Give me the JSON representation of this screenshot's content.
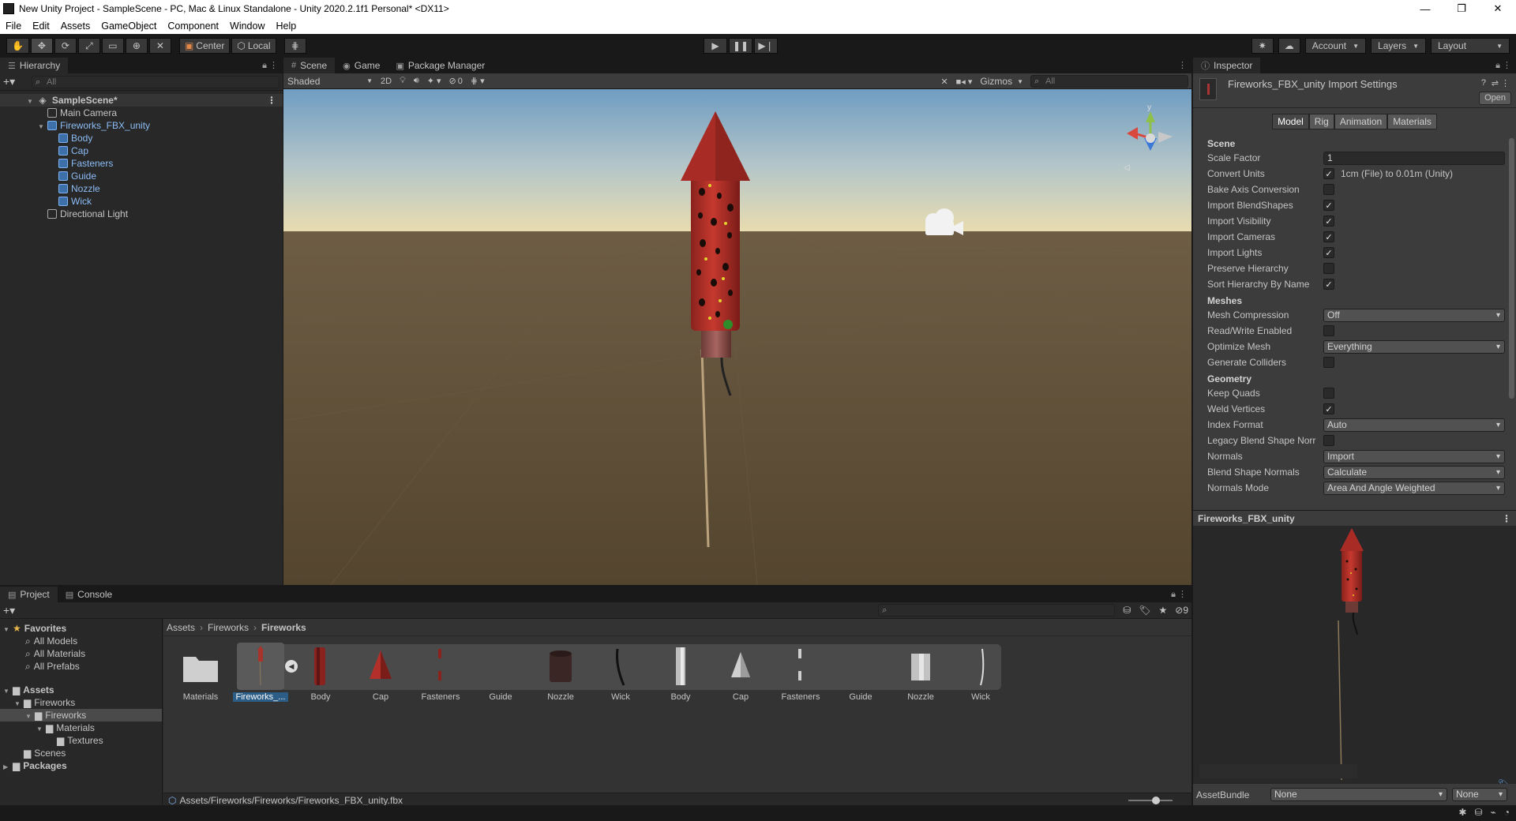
{
  "window": {
    "title": "New Unity Project - SampleScene - PC, Mac & Linux Standalone - Unity 2020.2.1f1 Personal* <DX11>",
    "controls": [
      "—",
      "❐",
      "✕"
    ]
  },
  "menu": [
    "File",
    "Edit",
    "Assets",
    "GameObject",
    "Component",
    "Window",
    "Help"
  ],
  "toolbar": {
    "pivot": "Center",
    "space": "Local",
    "account": "Account",
    "layers": "Layers",
    "layout": "Layout"
  },
  "hierarchy": {
    "tab": "Hierarchy",
    "search_placeholder": "All",
    "scene": "SampleScene*",
    "items": [
      {
        "label": "Main Camera",
        "depth": 1,
        "prefab": false,
        "expand": ""
      },
      {
        "label": "Fireworks_FBX_unity",
        "depth": 1,
        "prefab": true,
        "expand": "▼"
      },
      {
        "label": "Body",
        "depth": 2,
        "prefab": true,
        "expand": ""
      },
      {
        "label": "Cap",
        "depth": 2,
        "prefab": true,
        "expand": ""
      },
      {
        "label": "Fasteners",
        "depth": 2,
        "prefab": true,
        "expand": ""
      },
      {
        "label": "Guide",
        "depth": 2,
        "prefab": true,
        "expand": ""
      },
      {
        "label": "Nozzle",
        "depth": 2,
        "prefab": true,
        "expand": ""
      },
      {
        "label": "Wick",
        "depth": 2,
        "prefab": true,
        "expand": ""
      },
      {
        "label": "Directional Light",
        "depth": 1,
        "prefab": false,
        "expand": ""
      }
    ]
  },
  "scene_tabs": {
    "scene": "Scene",
    "game": "Game",
    "package_manager": "Package Manager"
  },
  "scene_toolbar": {
    "shading": "Shaded",
    "mode_2d": "2D",
    "hidden_count": "0",
    "gizmos": "Gizmos",
    "search_placeholder": "All"
  },
  "inspector": {
    "tab": "Inspector",
    "title": "Fireworks_FBX_unity Import Settings",
    "open_button": "Open",
    "tabs": [
      "Model",
      "Rig",
      "Animation",
      "Materials"
    ],
    "sections": [
      {
        "title": "Scene",
        "rows": [
          {
            "label": "Scale Factor",
            "type": "text",
            "value": "1"
          },
          {
            "label": "Convert Units",
            "type": "check",
            "checked": true,
            "note": "1cm (File) to 0.01m (Unity)"
          },
          {
            "label": "Bake Axis Conversion",
            "type": "check",
            "checked": false
          },
          {
            "label": "Import BlendShapes",
            "type": "check",
            "checked": true
          },
          {
            "label": "Import Visibility",
            "type": "check",
            "checked": true
          },
          {
            "label": "Import Cameras",
            "type": "check",
            "checked": true
          },
          {
            "label": "Import Lights",
            "type": "check",
            "checked": true
          },
          {
            "label": "Preserve Hierarchy",
            "type": "check",
            "checked": false
          },
          {
            "label": "Sort Hierarchy By Name",
            "type": "check",
            "checked": true
          }
        ]
      },
      {
        "title": "Meshes",
        "rows": [
          {
            "label": "Mesh Compression",
            "type": "dropdown",
            "value": "Off"
          },
          {
            "label": "Read/Write Enabled",
            "type": "check",
            "checked": false
          },
          {
            "label": "Optimize Mesh",
            "type": "dropdown",
            "value": "Everything"
          },
          {
            "label": "Generate Colliders",
            "type": "check",
            "checked": false
          }
        ]
      },
      {
        "title": "Geometry",
        "rows": [
          {
            "label": "Keep Quads",
            "type": "check",
            "checked": false
          },
          {
            "label": "Weld Vertices",
            "type": "check",
            "checked": true
          },
          {
            "label": "Index Format",
            "type": "dropdown",
            "value": "Auto"
          },
          {
            "label": "Legacy Blend Shape Norr",
            "type": "check",
            "checked": false
          },
          {
            "label": "Normals",
            "type": "dropdown",
            "value": "Import"
          },
          {
            "label": "Blend Shape Normals",
            "type": "dropdown",
            "value": "Calculate"
          },
          {
            "label": "Normals Mode",
            "type": "dropdown",
            "value": "Area And Angle Weighted"
          }
        ]
      }
    ],
    "preview_title": "Fireworks_FBX_unity",
    "assetbundle_label": "AssetBundle",
    "assetbundle_value": "None",
    "assetbundle_variant": "None"
  },
  "project": {
    "tabs": [
      "Project",
      "Console"
    ],
    "favorites": {
      "title": "Favorites",
      "items": [
        "All Models",
        "All Materials",
        "All Prefabs"
      ]
    },
    "assets_root": "Assets",
    "tree": [
      {
        "label": "Fireworks",
        "depth": 1,
        "selected": false,
        "expand": "▼"
      },
      {
        "label": "Fireworks",
        "depth": 2,
        "selected": true,
        "expand": "▼"
      },
      {
        "label": "Materials",
        "depth": 3,
        "selected": false,
        "expand": "▼"
      },
      {
        "label": "Textures",
        "depth": 4,
        "selected": false,
        "expand": ""
      },
      {
        "label": "Scenes",
        "depth": 1,
        "selected": false,
        "expand": ""
      }
    ],
    "packages": "Packages",
    "breadcrumb": [
      "Assets",
      "Fireworks",
      "Fireworks"
    ],
    "hidden_count": "9",
    "assets": [
      {
        "name": "Materials",
        "kind": "folder"
      },
      {
        "name": "Fireworks_...",
        "kind": "model",
        "selected": true
      },
      {
        "name": "Body",
        "kind": "body"
      },
      {
        "name": "Cap",
        "kind": "cap"
      },
      {
        "name": "Fasteners",
        "kind": "fasteners"
      },
      {
        "name": "Guide",
        "kind": "guide"
      },
      {
        "name": "Nozzle",
        "kind": "nozzle"
      },
      {
        "name": "Wick",
        "kind": "wick"
      },
      {
        "name": "Body",
        "kind": "mesh-body"
      },
      {
        "name": "Cap",
        "kind": "mesh-cap"
      },
      {
        "name": "Fasteners",
        "kind": "mesh-fasteners"
      },
      {
        "name": "Guide",
        "kind": "mesh-guide"
      },
      {
        "name": "Nozzle",
        "kind": "mesh-nozzle"
      },
      {
        "name": "Wick",
        "kind": "mesh-wick"
      }
    ],
    "path": "Assets/Fireworks/Fireworks/Fireworks_FBX_unity.fbx"
  },
  "colors": {
    "rocket_red": "#b3302a",
    "sky_top": "#7ea6c5",
    "ground": "#5d4d35",
    "prefab_blue": "#8cbcf5"
  }
}
